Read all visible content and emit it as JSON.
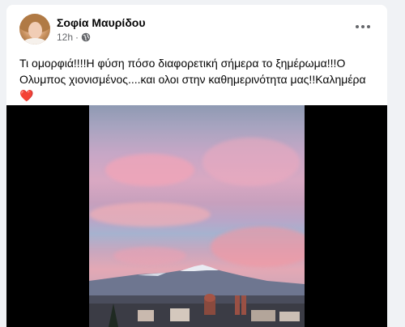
{
  "post": {
    "author": "Σοφία Μαυρίδου",
    "time": "12h",
    "separator": "·",
    "audience_icon": "globe-icon",
    "options_icon": "more-options-icon",
    "text_main": "Τι ομορφιά!!!!Η φύση πόσο διαφορετική σήμερα  το ξημέρωμα!!!Ο Ολυμπος χιονισμένος....και ολοι στην καθημερινότητα μας!!Καλημέρα",
    "text_emoji": "❤️"
  },
  "colors": {
    "heart": "#e0245e",
    "meta_text": "#65676b",
    "feed_bg": "#f0f2f5"
  }
}
